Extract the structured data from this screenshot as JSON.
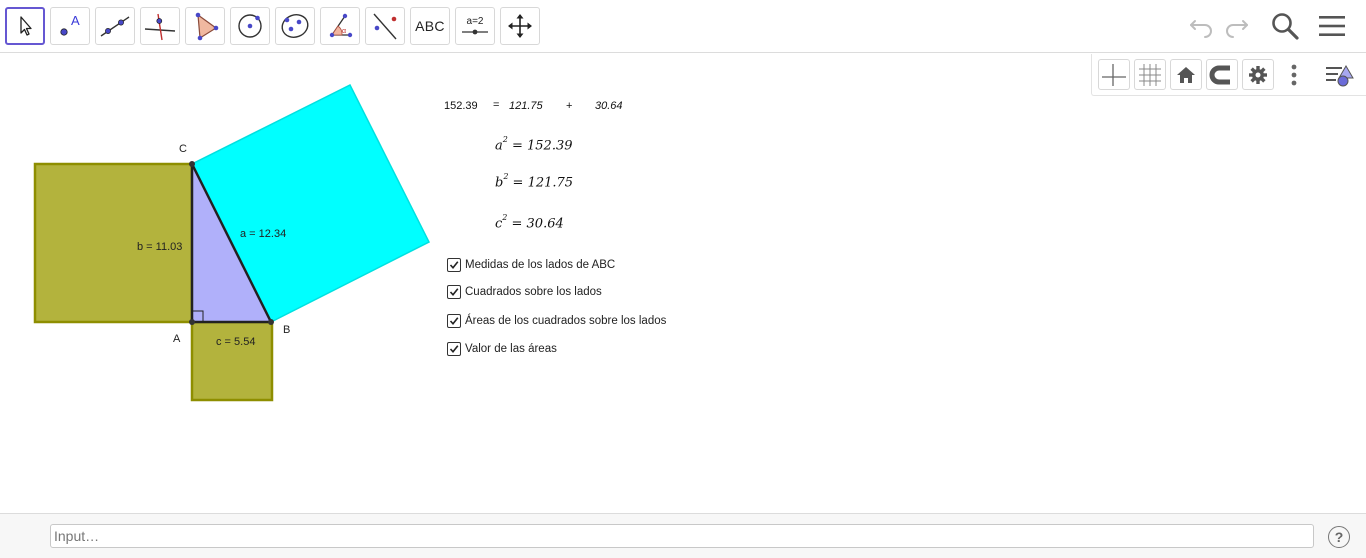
{
  "toolbar": {
    "tools": [
      {
        "name": "move-tool"
      },
      {
        "name": "point-tool"
      },
      {
        "name": "line-tool"
      },
      {
        "name": "perpendicular-line-tool"
      },
      {
        "name": "polygon-tool"
      },
      {
        "name": "circle-tool"
      },
      {
        "name": "ellipse-tool"
      },
      {
        "name": "angle-tool"
      },
      {
        "name": "reflect-tool"
      },
      {
        "name": "text-tool",
        "label": "ABC"
      },
      {
        "name": "slider-tool",
        "label": "a=2"
      },
      {
        "name": "move-graphics-view-tool"
      }
    ],
    "right": [
      "undo-icon",
      "redo-icon",
      "search-icon",
      "menu-icon"
    ]
  },
  "stylebar": {
    "buttons": [
      "axes-icon",
      "grid-icon",
      "home-icon",
      "magnet-icon",
      "gear-icon",
      "more-vertical-icon",
      "style-bar-toggle-icon"
    ]
  },
  "graphics": {
    "points": {
      "A": "A",
      "B": "B",
      "C": "C"
    },
    "side_labels": {
      "a": "a = 12.34",
      "b": "b = 11.03",
      "c": "c = 5.54"
    },
    "sum_line": {
      "total": "152.39",
      "equals": "=",
      "term1": "121.75",
      "plus": "+",
      "term2": "30.64"
    },
    "equations": {
      "a": {
        "var": "a",
        "exp": "2",
        "rhs": " = 152.39"
      },
      "b": {
        "var": "b",
        "exp": "2",
        "rhs": " = 121.75"
      },
      "c": {
        "var": "c",
        "exp": "2",
        "rhs": " = 30.64"
      }
    },
    "checkboxes": [
      {
        "label": "Medidas de los lados de ABC",
        "checked": true
      },
      {
        "label": "Cuadrados sobre los lados",
        "checked": true
      },
      {
        "label": "Áreas de los cuadrados sobre los lados",
        "checked": true
      },
      {
        "label": "Valor de las áreas",
        "checked": true
      }
    ],
    "colors": {
      "triangle": "#aeaefa",
      "square_hyp": "#00ffff",
      "square_legs": "#b4b43c",
      "square_legs_stroke": "#8c8c00"
    }
  },
  "input_bar": {
    "placeholder": "Input…",
    "help": "?"
  }
}
